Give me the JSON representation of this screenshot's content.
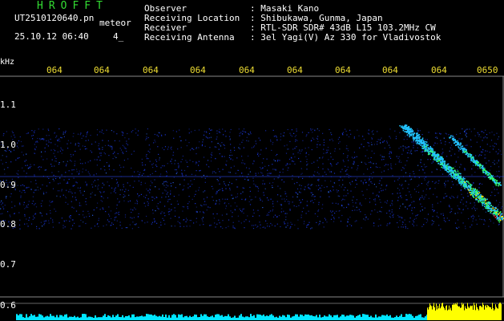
{
  "header": {
    "app_title": "HROFFT",
    "file_name": "UT2510120640.pn",
    "file_tag": "meteor",
    "timestamp": "25.10.12 06:40",
    "minute_count": "4_"
  },
  "station": [
    {
      "label": "Observer",
      "value": ": Masaki Kano"
    },
    {
      "label": "Receiving Location",
      "value": ": Shibukawa, Gunma, Japan"
    },
    {
      "label": "Receiver",
      "value": ": RTL-SDR SDR# 43dB L15 103.2MHz CW"
    },
    {
      "label": "Receiving Antenna",
      "value": ": 3el Yagi(V) Az 330 for Vladivostok"
    }
  ],
  "spectrogram": {
    "unit_label": "kHz",
    "time_ticks": [
      "064",
      "064",
      "064",
      "064",
      "064",
      "064",
      "064",
      "064",
      "064",
      "0650"
    ],
    "freq_ticks": [
      "1.1",
      "1.0",
      "0.9",
      "0.8",
      "0.7",
      "0.6"
    ],
    "background_color": "#000000",
    "noise_color": "#1a35d8",
    "meteor_colors": [
      "#22c3ff",
      "#33ff66",
      "#ffee00",
      "#ff2222"
    ],
    "level_colors": [
      "#00e5ff",
      "#ffff00"
    ]
  }
}
